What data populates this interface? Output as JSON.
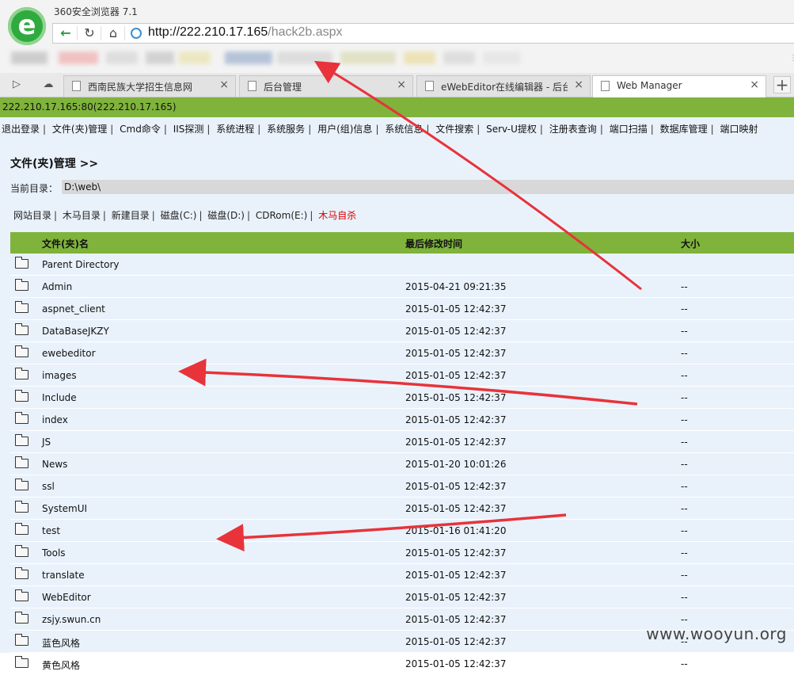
{
  "browser": {
    "app_title": "360安全浏览器 7.1",
    "url_host": "http://222.210.17.165",
    "url_path": "/hack2b.aspx",
    "tabs": [
      {
        "label": "西南民族大学招生信息网",
        "active": false
      },
      {
        "label": "后台管理",
        "active": false
      },
      {
        "label": "eWebEditor在线编辑器 - 后台管理",
        "active": false
      },
      {
        "label": "Web Manager",
        "active": true
      }
    ],
    "new_tab": "+",
    "close_glyph": "×"
  },
  "page": {
    "host_line": "222.210.17.165:80(222.210.17.165)",
    "menu": [
      "退出登录",
      "文件(夹)管理",
      "Cmd命令",
      "IIS探测",
      "系统进程",
      "系统服务",
      "用户(组)信息",
      "系统信息",
      "文件搜索",
      "Serv-U提权",
      "注册表查询",
      "端口扫描",
      "数据库管理",
      "端口映射"
    ],
    "section_title": "文件(夹)管理  >>",
    "current_dir_label": "当前目录：",
    "current_dir_value": "D:\\web\\",
    "quick_links": [
      "网站目录",
      "木马目录",
      "新建目录",
      "磁盘(C:)",
      "磁盘(D:)",
      "CDRom(E:)"
    ],
    "danger_link": "木马自杀",
    "table": {
      "headers": {
        "name": "文件(夹)名",
        "mtime": "最后修改时间",
        "size": "大小"
      },
      "rows": [
        {
          "name": "Parent Directory",
          "mtime": "",
          "size": ""
        },
        {
          "name": "Admin",
          "mtime": "2015-04-21 09:21:35",
          "size": "--"
        },
        {
          "name": "aspnet_client",
          "mtime": "2015-01-05 12:42:37",
          "size": "--"
        },
        {
          "name": "DataBaseJKZY",
          "mtime": "2015-01-05 12:42:37",
          "size": "--"
        },
        {
          "name": "ewebeditor",
          "mtime": "2015-01-05 12:42:37",
          "size": "--"
        },
        {
          "name": "images",
          "mtime": "2015-01-05 12:42:37",
          "size": "--"
        },
        {
          "name": "Include",
          "mtime": "2015-01-05 12:42:37",
          "size": "--"
        },
        {
          "name": "index",
          "mtime": "2015-01-05 12:42:37",
          "size": "--"
        },
        {
          "name": "JS",
          "mtime": "2015-01-05 12:42:37",
          "size": "--"
        },
        {
          "name": "News",
          "mtime": "2015-01-20 10:01:26",
          "size": "--"
        },
        {
          "name": "ssl",
          "mtime": "2015-01-05 12:42:37",
          "size": "--"
        },
        {
          "name": "SystemUI",
          "mtime": "2015-01-05 12:42:37",
          "size": "--"
        },
        {
          "name": "test",
          "mtime": "2015-01-16 01:41:20",
          "size": "--"
        },
        {
          "name": "Tools",
          "mtime": "2015-01-05 12:42:37",
          "size": "--"
        },
        {
          "name": "translate",
          "mtime": "2015-01-05 12:42:37",
          "size": "--"
        },
        {
          "name": "WebEditor",
          "mtime": "2015-01-05 12:42:37",
          "size": "--"
        },
        {
          "name": "zsjy.swun.cn",
          "mtime": "2015-01-05 12:42:37",
          "size": "--"
        },
        {
          "name": "蓝色风格",
          "mtime": "2015-01-05 12:42:37",
          "size": "--"
        },
        {
          "name": "黄色风格",
          "mtime": "2015-01-05 12:42:37",
          "size": "--"
        }
      ]
    },
    "watermark": "www.wooyun.org"
  },
  "colors": {
    "accent_green": "#7fb33b",
    "page_bg": "#e9f2fb",
    "danger": "#dd0000",
    "annotation_arrow": "#e8333a"
  },
  "icons": {
    "back": "arrow-left-icon",
    "reload": "reload-icon",
    "home": "home-icon",
    "globe": "globe-icon",
    "folder": "folder-icon",
    "page": "page-icon",
    "cloud": "cloud-icon",
    "sidebar_toggle": "sidebar-toggle-icon"
  }
}
